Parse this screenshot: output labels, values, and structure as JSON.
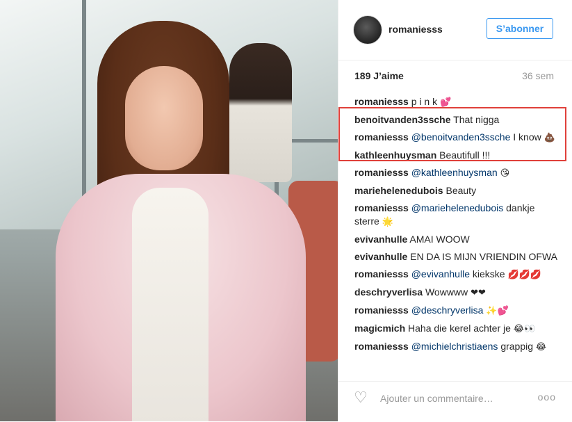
{
  "post": {
    "username": "romaniesss",
    "follow_label": "S’abonner",
    "likes": "189 J’aime",
    "age": "36 sem"
  },
  "comments": [
    {
      "user": "romaniesss",
      "text": "p i n k",
      "emoji": "💕"
    },
    {
      "user": "benoitvanden3ssche",
      "text": "That nigga"
    },
    {
      "user": "romaniesss",
      "mention": "@benoitvanden3ssche",
      "text": "I know",
      "emoji": "💩"
    },
    {
      "user": "kathleenhuysman",
      "text": "Beautifull !!!"
    },
    {
      "user": "romaniesss",
      "mention": "@kathleenhuysman",
      "text": "",
      "emoji": "😘"
    },
    {
      "user": "mariehelenedubois",
      "text": "Beauty"
    },
    {
      "user": "romaniesss",
      "mention": "@mariehelenedubois",
      "text": "dankje sterre",
      "emoji": "🌟"
    },
    {
      "user": "evivanhulle",
      "text": "AMAI WOOW"
    },
    {
      "user": "evivanhulle",
      "text": "EN DA IS MIJN VRIENDIN OFWA"
    },
    {
      "user": "romaniesss",
      "mention": "@evivanhulle",
      "text": "kiekske",
      "emoji": "💋💋💋"
    },
    {
      "user": "deschryverlisa",
      "text": "Wowwww",
      "emoji": "❤❤"
    },
    {
      "user": "romaniesss",
      "mention": "@deschryverlisa",
      "text": "",
      "emoji": "✨💕"
    },
    {
      "user": "magicmich",
      "text": "Haha die kerel achter je",
      "emoji": "😂👀"
    },
    {
      "user": "romaniesss",
      "mention": "@michielchristiaens",
      "text": "grappig",
      "emoji": "😂"
    }
  ],
  "footer": {
    "input_placeholder": "Ajouter un commentaire…",
    "more_label": "ooo"
  },
  "icons": {
    "like": "heart-outline-icon",
    "more": "more-options-icon"
  },
  "colors": {
    "accent": "#3897f0",
    "highlight_box": "#e0403a",
    "mention": "#003569"
  }
}
